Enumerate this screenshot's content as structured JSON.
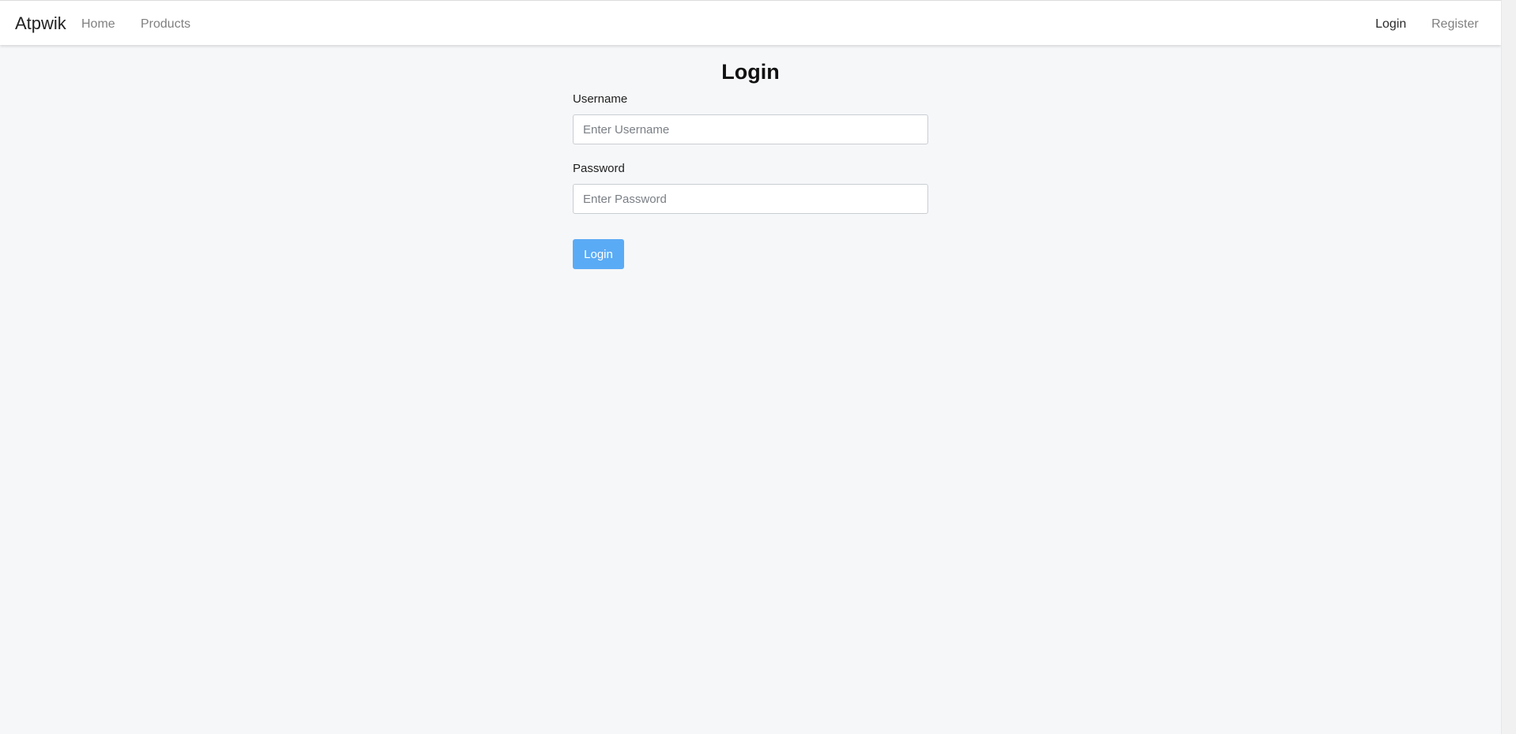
{
  "navbar": {
    "brand": "Atpwik",
    "links": [
      {
        "label": "Home"
      },
      {
        "label": "Products"
      }
    ],
    "auth_links": [
      {
        "label": "Login",
        "active": true
      },
      {
        "label": "Register",
        "active": false
      }
    ]
  },
  "login_form": {
    "title": "Login",
    "username_label": "Username",
    "username_placeholder": "Enter Username",
    "username_value": "",
    "password_label": "Password",
    "password_placeholder": "Enter Password",
    "password_value": "",
    "submit_label": "Login"
  },
  "colors": {
    "primary_button": "#5aabf5",
    "background": "#f6f7f9",
    "navbar_bg": "#ffffff"
  }
}
